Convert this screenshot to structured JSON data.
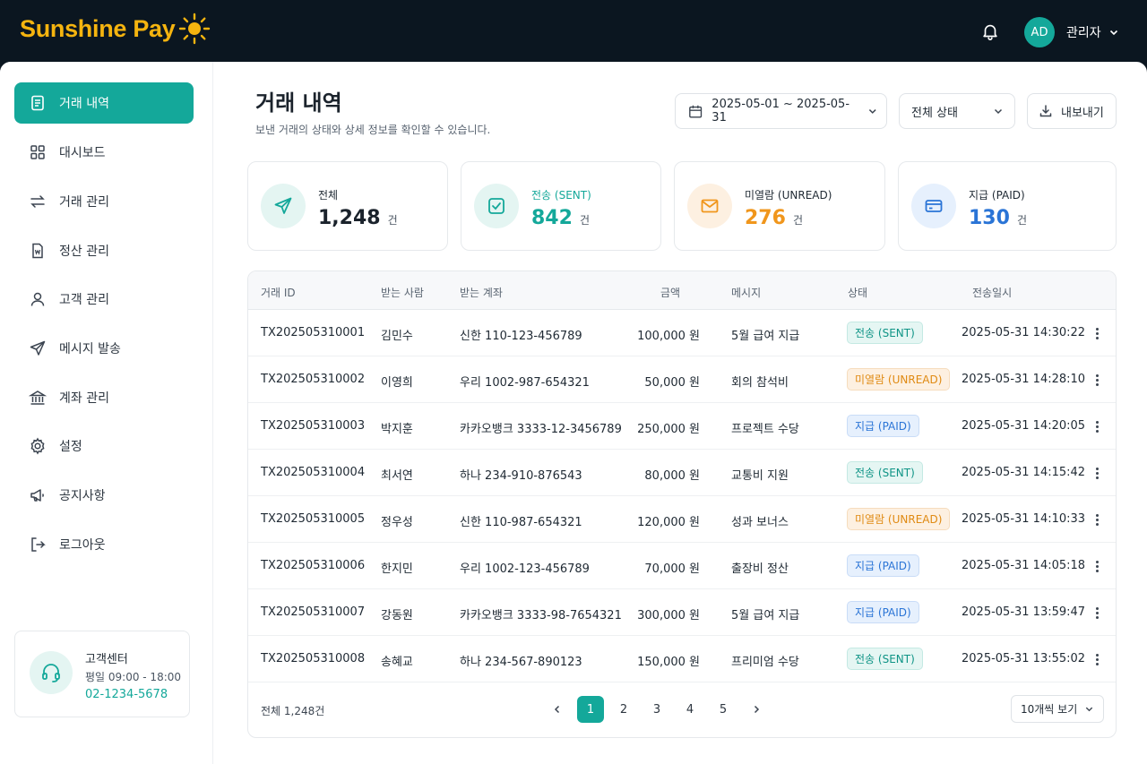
{
  "brand": {
    "name": "Sunshine Pay"
  },
  "header": {
    "avatar_initials": "AD",
    "user_label": "관리자"
  },
  "sidebar": {
    "items": [
      {
        "label": "거래 내역",
        "icon": "document-icon",
        "active": true
      },
      {
        "label": "대시보드",
        "icon": "grid-icon",
        "active": false
      },
      {
        "label": "거래 관리",
        "icon": "transfer-arrows-icon",
        "active": false
      },
      {
        "label": "정산 관리",
        "icon": "won-document-icon",
        "active": false
      },
      {
        "label": "고객 관리",
        "icon": "user-icon",
        "active": false
      },
      {
        "label": "메시지 발송",
        "icon": "send-icon",
        "active": false
      },
      {
        "label": "계좌 관리",
        "icon": "bank-icon",
        "active": false
      },
      {
        "label": "설정",
        "icon": "gear-icon",
        "active": false
      },
      {
        "label": "공지사항",
        "icon": "megaphone-icon",
        "active": false
      },
      {
        "label": "로그아웃",
        "icon": "logout-icon",
        "active": false
      }
    ],
    "support": {
      "title": "고객센터",
      "hours": "평일 09:00 - 18:00",
      "phone": "02-1234-5678"
    }
  },
  "page": {
    "title": "거래 내역",
    "description": "보낸 거래의 상태와 상세 정보를 확인할 수 있습니다."
  },
  "filters": {
    "date_range": "2025-05-01 ~ 2025-05-31",
    "status_select": "전체 상태",
    "export_label": "내보내기"
  },
  "summary": [
    {
      "label": "전체",
      "value": "1,248",
      "unit": "건",
      "color": "#1b232c",
      "icon": "send-icon"
    },
    {
      "label": "전송 (SENT)",
      "value": "842",
      "unit": "건",
      "color": "#14a89a",
      "icon": "check-square-icon"
    },
    {
      "label": "미열람 (UNREAD)",
      "value": "276",
      "unit": "건",
      "color": "#f0961c",
      "icon": "mail-icon"
    },
    {
      "label": "지급 (PAID)",
      "value": "130",
      "unit": "건",
      "color": "#2a74d6",
      "icon": "card-icon"
    }
  ],
  "table": {
    "columns": [
      "거래 ID",
      "받는 사람",
      "받는 계좌",
      "금액",
      "메시지",
      "상태",
      "전송일시"
    ],
    "rows": [
      {
        "id": "TX202505310001",
        "recipient": "김민수",
        "account": "신한 110-123-456789",
        "amount": "100,000 원",
        "message": "5월 급여 지급",
        "status": "전송 (SENT)",
        "status_type": "sent",
        "sent_at": "2025-05-31 14:30:22"
      },
      {
        "id": "TX202505310002",
        "recipient": "이영희",
        "account": "우리 1002-987-654321",
        "amount": "50,000 원",
        "message": "회의 참석비",
        "status": "미열람 (UNREAD)",
        "status_type": "unread",
        "sent_at": "2025-05-31 14:28:10"
      },
      {
        "id": "TX202505310003",
        "recipient": "박지훈",
        "account": "카카오뱅크 3333-12-3456789",
        "amount": "250,000 원",
        "message": "프로젝트 수당",
        "status": "지급 (PAID)",
        "status_type": "paid",
        "sent_at": "2025-05-31 14:20:05"
      },
      {
        "id": "TX202505310004",
        "recipient": "최서연",
        "account": "하나 234-910-876543",
        "amount": "80,000 원",
        "message": "교통비 지원",
        "status": "전송 (SENT)",
        "status_type": "sent",
        "sent_at": "2025-05-31 14:15:42"
      },
      {
        "id": "TX202505310005",
        "recipient": "정우성",
        "account": "신한 110-987-654321",
        "amount": "120,000 원",
        "message": "성과 보너스",
        "status": "미열람 (UNREAD)",
        "status_type": "unread",
        "sent_at": "2025-05-31 14:10:33"
      },
      {
        "id": "TX202505310006",
        "recipient": "한지민",
        "account": "우리 1002-123-456789",
        "amount": "70,000 원",
        "message": "출장비 정산",
        "status": "지급 (PAID)",
        "status_type": "paid",
        "sent_at": "2025-05-31 14:05:18"
      },
      {
        "id": "TX202505310007",
        "recipient": "강동원",
        "account": "카카오뱅크 3333-98-7654321",
        "amount": "300,000 원",
        "message": "5월 급여 지급",
        "status": "지급 (PAID)",
        "status_type": "paid",
        "sent_at": "2025-05-31 13:59:47"
      },
      {
        "id": "TX202505310008",
        "recipient": "송혜교",
        "account": "하나 234-567-890123",
        "amount": "150,000 원",
        "message": "프리미엄 수당",
        "status": "전송 (SENT)",
        "status_type": "sent",
        "sent_at": "2025-05-31 13:55:02"
      }
    ]
  },
  "pagination": {
    "total_label": "전체 1,248건",
    "pages": [
      "1",
      "2",
      "3",
      "4",
      "5"
    ],
    "current": "1",
    "per_page": "10개씩 보기"
  }
}
